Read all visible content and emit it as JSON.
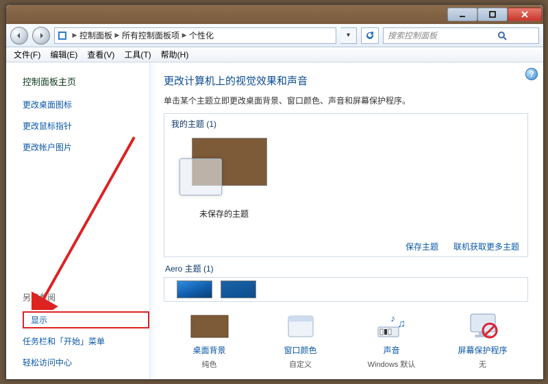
{
  "address": {
    "root": "控制面板",
    "sub": "所有控制面板项",
    "leaf": "个性化"
  },
  "search": {
    "placeholder": "搜索控制面板"
  },
  "menu": {
    "file": "文件(F)",
    "edit": "编辑(E)",
    "view": "查看(V)",
    "tools": "工具(T)",
    "help": "帮助(H)"
  },
  "side": {
    "home": "控制面板主页",
    "desktop_icons": "更改桌面图标",
    "mouse_pointers": "更改鼠标指针",
    "account_picture": "更改帐户图片",
    "see_also": "另请参阅",
    "display": "显示",
    "taskbar": "任务栏和「开始」菜单",
    "ease": "轻松访问中心"
  },
  "main": {
    "title": "更改计算机上的视觉效果和声音",
    "subtitle": "单击某个主题立即更改桌面背景、窗口颜色、声音和屏幕保护程序。",
    "my_themes_label": "我的主题 (1)",
    "unsaved_theme": "未保存的主题",
    "save_theme": "保存主题",
    "get_more": "联机获取更多主题",
    "aero_label": "Aero 主题 (1)",
    "bottom": {
      "bg_label": "桌面背景",
      "bg_value": "纯色",
      "color_label": "窗口颜色",
      "color_value": "自定义",
      "sound_label": "声音",
      "sound_value": "Windows 默认",
      "saver_label": "屏幕保护程序",
      "saver_value": "无"
    }
  }
}
